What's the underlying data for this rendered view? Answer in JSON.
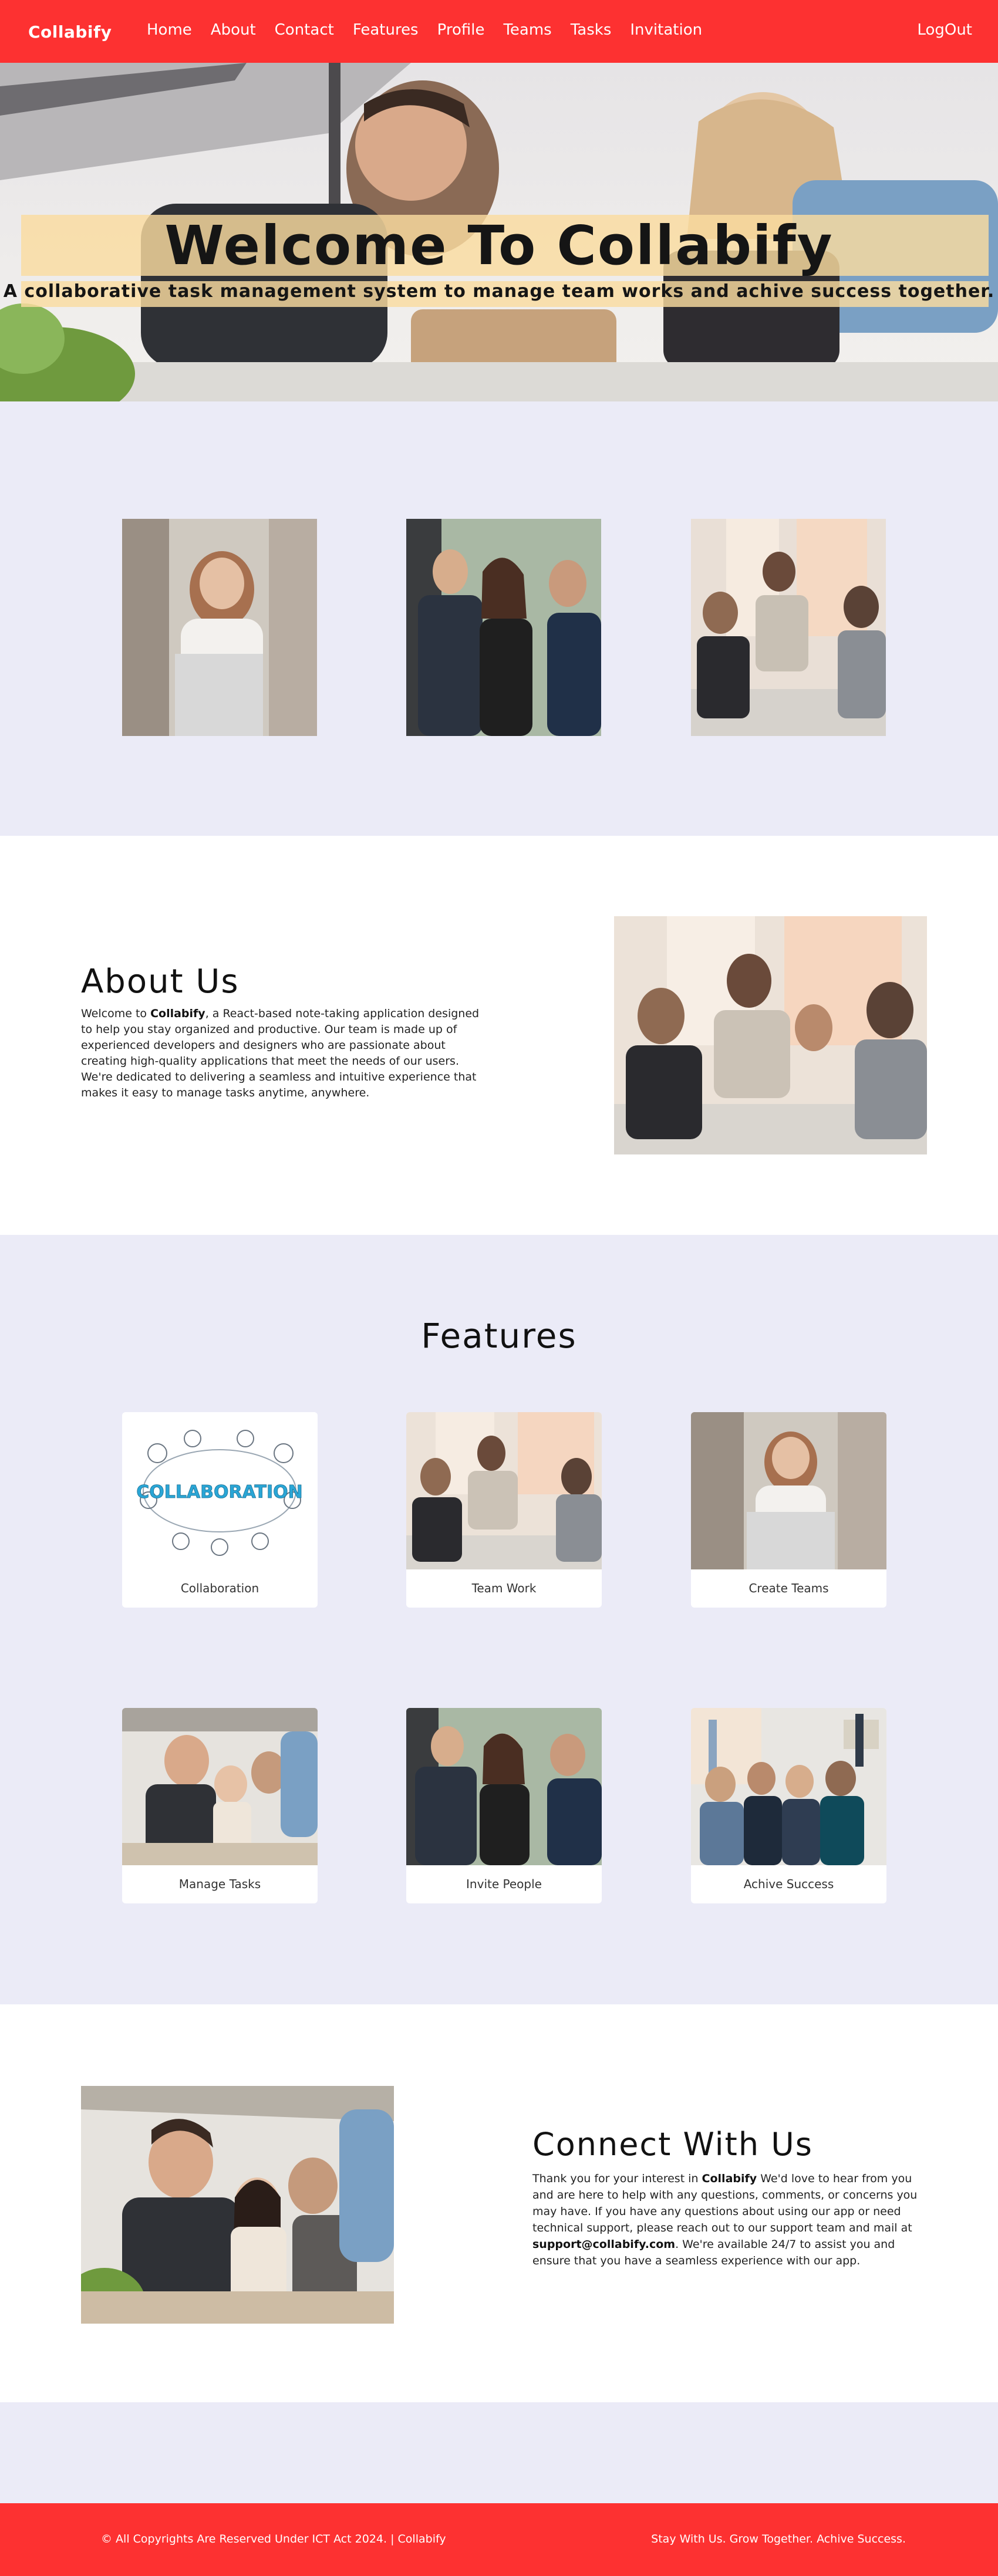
{
  "nav": {
    "brand": "Collabify",
    "items": [
      "Home",
      "About",
      "Contact",
      "Features",
      "Profile",
      "Teams",
      "Tasks",
      "Invitation"
    ],
    "logout": "LogOut"
  },
  "hero": {
    "title": "Welcome To Collabify",
    "subtitle": "A collaborative task management system to manage team works and achive success together."
  },
  "about": {
    "heading": "About Us",
    "text_before": "Welcome to ",
    "brand": "Collabify",
    "text_after": ", a React-based note-taking application designed to help you stay organized and productive. Our team is made up of experienced developers and designers who are passionate about creating high-quality applications that meet the needs of our users. We're dedicated to delivering a seamless and intuitive experience that makes it easy to manage tasks anytime, anywhere."
  },
  "features": {
    "heading": "Features",
    "cards": [
      {
        "label": "Collaboration",
        "logo_text": "COLLABORATION"
      },
      {
        "label": "Team Work"
      },
      {
        "label": "Create Teams"
      },
      {
        "label": "Manage Tasks"
      },
      {
        "label": "Invite People"
      },
      {
        "label": "Achive Success"
      }
    ]
  },
  "connect": {
    "heading": "Connect With Us",
    "text_1": "Thank you for your interest in ",
    "brand": "Collabify",
    "text_2": " We'd love to hear from you and are here to help with any questions, comments, or concerns you may have. If you have any questions about using our app or need technical support, please reach out to our support team and mail at ",
    "email": "support@collabify.com",
    "text_3": ". We're available 24/7 to assist you and ensure that you have a seamless experience with our app."
  },
  "footer": {
    "left": "© All Copyrights Are Reserved Under ICT Act 2024. | Collabify",
    "right": "Stay With Us. Grow Together. Achive Success."
  },
  "colors": {
    "accent": "#fd3131",
    "section_bg": "#ebebf7",
    "hero_band": "#fadca0"
  }
}
